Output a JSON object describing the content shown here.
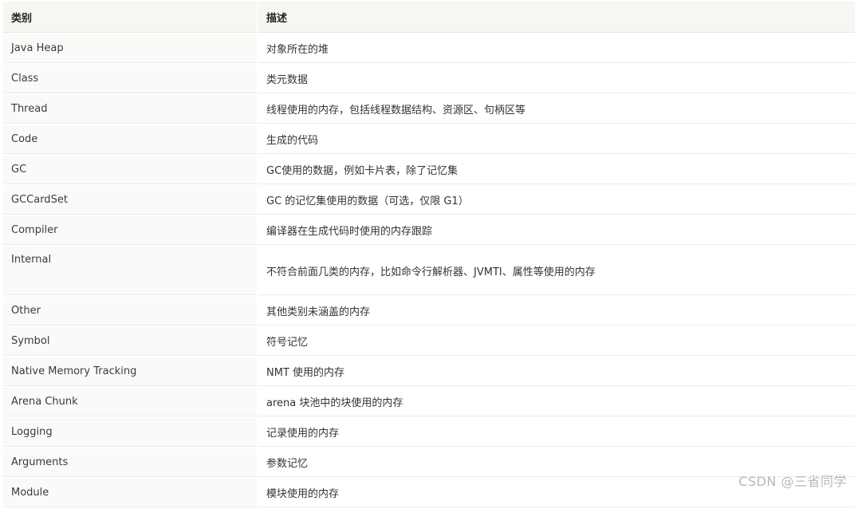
{
  "table": {
    "headers": [
      "类别",
      "描述"
    ],
    "rows": [
      {
        "category": "Java Heap",
        "description": "对象所在的堆"
      },
      {
        "category": "Class",
        "description": "类元数据"
      },
      {
        "category": "Thread",
        "description": "线程使用的内存，包括线程数据结构、资源区、句柄区等"
      },
      {
        "category": "Code",
        "description": "生成的代码"
      },
      {
        "category": "GC",
        "description": "GC使用的数据，例如卡片表，除了记忆集"
      },
      {
        "category": "GCCardSet",
        "description": "GC 的记忆集使用的数据（可选，仅限 G1）"
      },
      {
        "category": "Compiler",
        "description": "编译器在生成代码时使用的内存跟踪"
      },
      {
        "category": "Internal",
        "description": "不符合前面几类的内存，比如命令行解析器、JVMTI、属性等使用的内存"
      },
      {
        "category": "Other",
        "description": "其他类别未涵盖的内存"
      },
      {
        "category": "Symbol",
        "description": "符号记忆"
      },
      {
        "category": "Native Memory Tracking",
        "description": "NMT 使用的内存"
      },
      {
        "category": "Arena Chunk",
        "description": "arena 块池中的块使用的内存"
      },
      {
        "category": "Logging",
        "description": "记录使用的内存"
      },
      {
        "category": "Arguments",
        "description": "参数记忆"
      },
      {
        "category": "Module",
        "description": "模块使用的内存"
      }
    ]
  },
  "watermark": "CSDN @三省同学"
}
